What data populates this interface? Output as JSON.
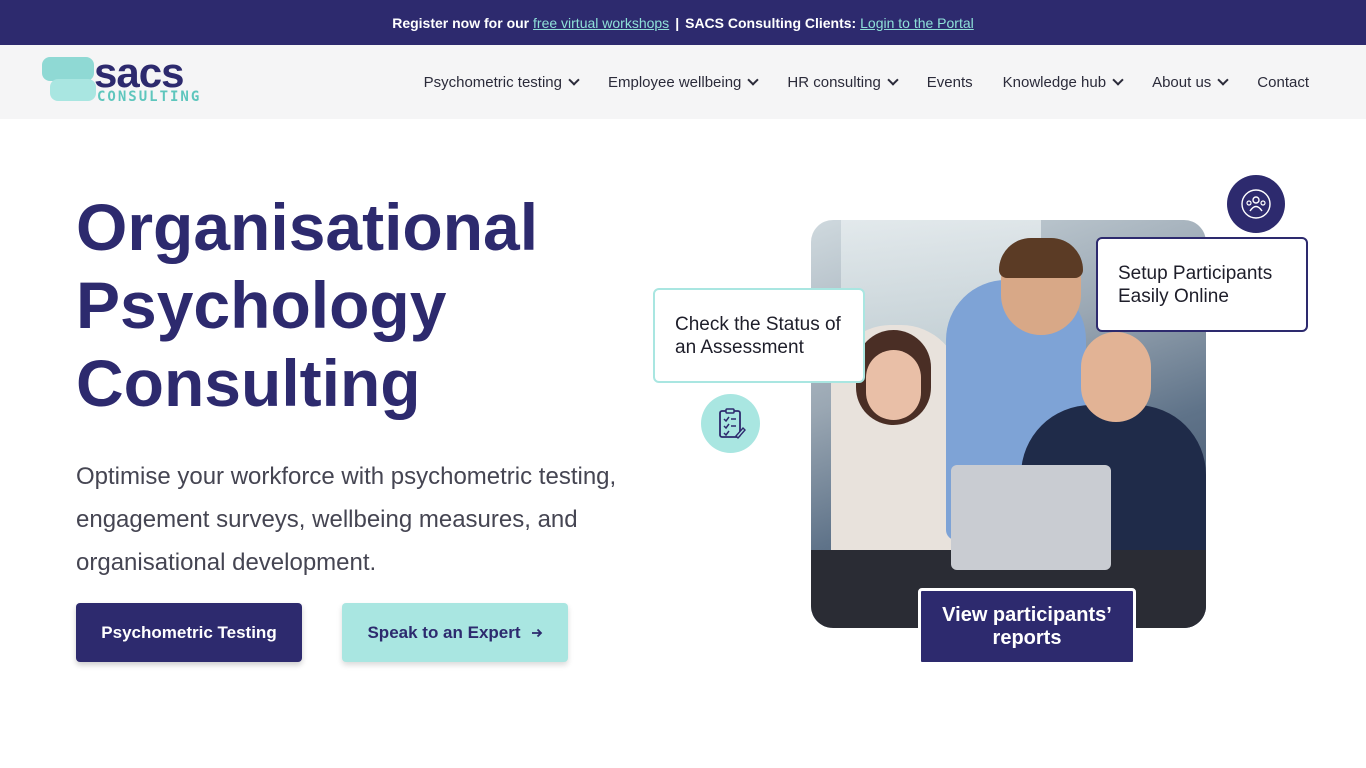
{
  "topbar": {
    "text_before": "Register now for our",
    "link_workshops": "free virtual workshops",
    "separator": "|",
    "text_clients": "SACS Consulting Clients:",
    "link_portal": "Login to the Portal"
  },
  "logo": {
    "word": "sacs",
    "sub": "CONSULTING",
    "icon": "speech-bubbles-icon"
  },
  "nav": {
    "items": [
      {
        "label": "Psychometric testing",
        "dropdown": true
      },
      {
        "label": "Employee wellbeing",
        "dropdown": true
      },
      {
        "label": "HR consulting",
        "dropdown": true
      },
      {
        "label": "Events",
        "dropdown": false
      },
      {
        "label": "Knowledge hub",
        "dropdown": true
      },
      {
        "label": "About us",
        "dropdown": true
      },
      {
        "label": "Contact",
        "dropdown": false
      }
    ]
  },
  "hero": {
    "title_line1": "Organisational",
    "title_line2": "Psychology",
    "title_line3": "Consulting",
    "subtitle": "Optimise your workforce with psychometric testing, engagement surveys, wellbeing measures, and organisational development.",
    "primary_button": "Psychometric Testing",
    "secondary_button": "Speak to an Expert",
    "secondary_icon": "arrow-right-icon"
  },
  "cards": {
    "status": "Check the Status of an Assessment",
    "setup": "Setup Participants Easily Online",
    "reports": "View participants’ reports"
  },
  "colors": {
    "brand_dark": "#2d2a6e",
    "brand_light": "#a9e6e1",
    "link": "#8ee0d8"
  }
}
